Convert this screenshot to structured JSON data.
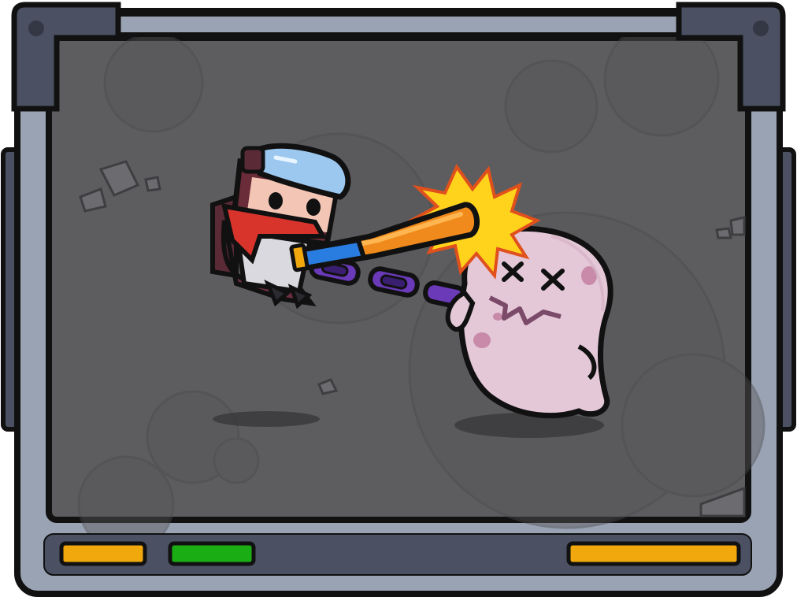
{
  "scene": {
    "description_free": true
  },
  "frame": {
    "bezel_color": "#9aa3b3",
    "bezel_dark": "#4b5163",
    "outline": "#111111",
    "screen_bg": "#5d5d5f"
  },
  "status_bar": {
    "indicators": [
      {
        "name": "left-indicator",
        "color": "#f0a80c"
      },
      {
        "name": "middle-indicator",
        "color": "#1aad14"
      },
      {
        "name": "right-indicator",
        "color": "#f0a80c"
      }
    ]
  },
  "characters": {
    "hero": {
      "icon": "hero-with-goggles-icon",
      "scarf_color": "#d9342b",
      "goggle_color": "#9cc8f0"
    },
    "bat": {
      "icon": "baseball-bat-icon",
      "color": "#f08a1c",
      "grip_color": "#2a7de0"
    },
    "chain": {
      "icon": "purple-chain-icon",
      "color": "#6a3ab8"
    },
    "ghost": {
      "icon": "knocked-out-ghost-icon",
      "color": "#e4c8d8",
      "state": "knocked-out"
    },
    "impact": {
      "icon": "impact-burst-icon",
      "color": "#ffd21c"
    }
  }
}
